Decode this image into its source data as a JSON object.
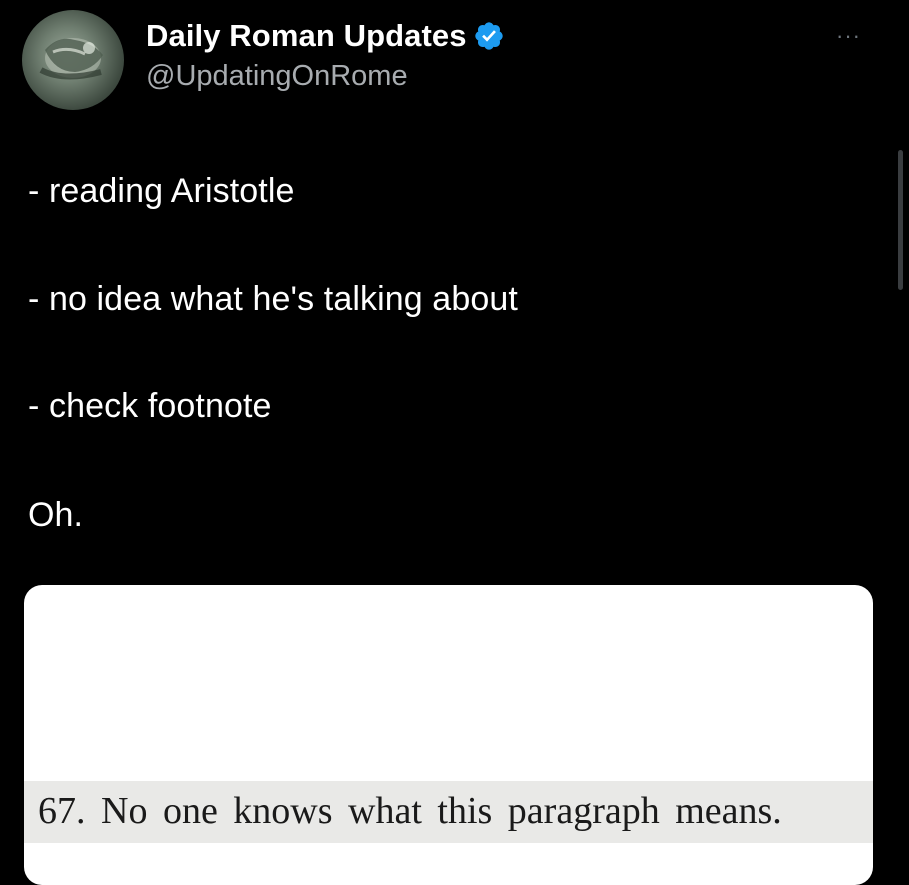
{
  "author": {
    "display_name": "Daily Roman Updates",
    "handle": "@UpdatingOnRome",
    "verified": true,
    "avatar_icon": "laurel-bust-avatar"
  },
  "menu": {
    "more_label": "···"
  },
  "tweet": {
    "lines": [
      "- reading Aristotle",
      "- no idea what he's talking about",
      "- check footnote",
      "Oh."
    ]
  },
  "media": {
    "footnote_text": "67. No one knows what this paragraph means."
  },
  "colors": {
    "background": "#000000",
    "text_primary": "#ffffff",
    "text_secondary": "#a8acb0",
    "verified_badge": "#1d9bf0",
    "media_bg": "#ffffff",
    "footnote_band": "#e9e9e7"
  }
}
